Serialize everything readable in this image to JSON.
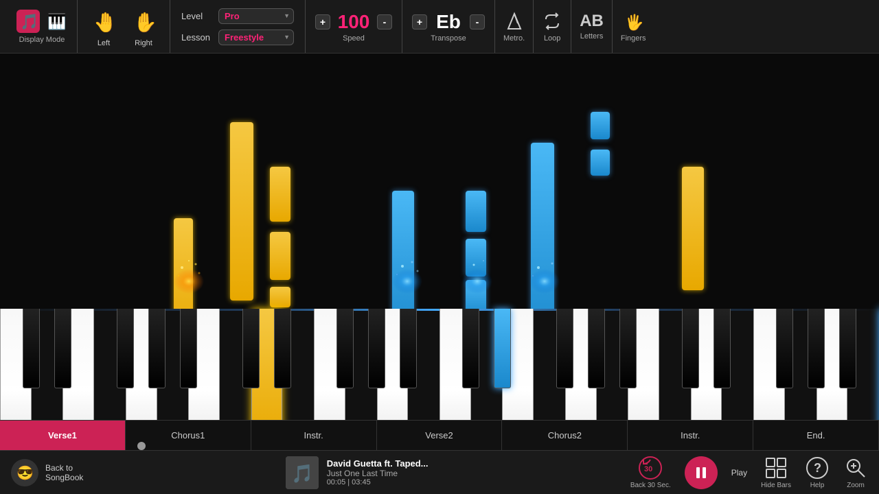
{
  "toolbar": {
    "display_mode_label": "Display Mode",
    "left_label": "Left",
    "right_label": "Right",
    "level_label": "Level",
    "level_value": "Pro",
    "lesson_label": "Lesson",
    "lesson_value": "Freestyle",
    "speed_plus": "+",
    "speed_minus": "-",
    "speed_value": "100",
    "speed_label": "Speed",
    "transpose_plus": "+",
    "transpose_minus": "-",
    "transpose_value": "Eb",
    "transpose_label": "Transpose",
    "metro_label": "Metro.",
    "loop_label": "Loop",
    "letters_label": "Letters",
    "fingers_label": "Fingers"
  },
  "sections": {
    "tabs": [
      "Verse1",
      "Chorus1",
      "Instr.",
      "Verse2",
      "Chorus2",
      "Instr.",
      "End."
    ],
    "active_tab": "Verse1"
  },
  "bottom_bar": {
    "back_line1": "Back to",
    "back_line2": "SongBook",
    "song_title": "David Guetta ft. Taped...",
    "song_subtitle": "Just One Last Time",
    "song_time": "00:05 | 03:45",
    "back30_label": "Back 30 Sec.",
    "play_label": "Play",
    "hide_bars_label": "Hide Bars",
    "help_label": "Help",
    "zoom_label": "Zoom"
  },
  "key_number": "4",
  "colors": {
    "yellow": "#f5c842",
    "blue": "#4ab8f5",
    "pink": "#cc2255",
    "bg": "#0a0a0a"
  }
}
